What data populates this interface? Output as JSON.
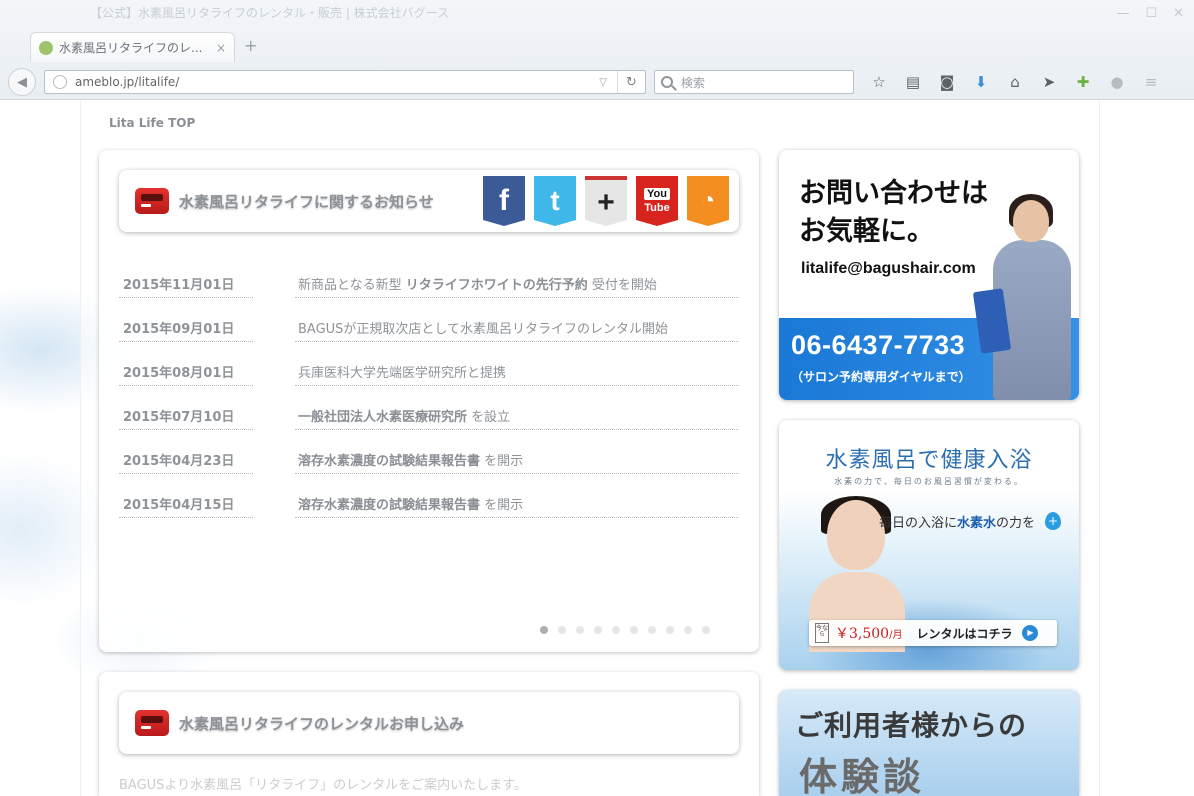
{
  "browser": {
    "window_title": "【公式】水素風呂リタライフのレンタル・販売 | 株式会社バグース",
    "tab_title": "水素風呂リタライフのレ...",
    "tab_close": "×",
    "new_tab": "+",
    "url": "ameblo.jp/litalife/",
    "search_placeholder": "検索"
  },
  "page": {
    "breadcrumb": "Lita Life TOP"
  },
  "news": {
    "title": "水素風呂リタライフに関するお知らせ",
    "social": [
      "f",
      "t",
      "+",
      "You",
      "Tube"
    ],
    "items": [
      {
        "date": "2015年11月01日",
        "pre": "新商品となる新型 ",
        "bold": "リタライフホワイトの先行予約",
        "post": " 受付を開始"
      },
      {
        "date": "2015年09月01日",
        "pre": "BAGUSが正規取次店として水素風呂リタライフのレンタル開始",
        "bold": "",
        "post": ""
      },
      {
        "date": "2015年08月01日",
        "pre": "兵庫医科大学先端医学研究所と提携",
        "bold": "",
        "post": ""
      },
      {
        "date": "2015年07月10日",
        "pre": "",
        "bold": "一般社団法人水素医療研究所",
        "post": " を設立"
      },
      {
        "date": "2015年04月23日",
        "pre": "",
        "bold": "溶存水素濃度の試験結果報告書",
        "post": " を開示"
      },
      {
        "date": "2015年04月15日",
        "pre": "",
        "bold": "溶存水素濃度の試験結果報告書",
        "post": " を開示"
      }
    ],
    "pager_count": 10,
    "pager_active": 0
  },
  "rental": {
    "title": "水素風呂リタライフのレンタルお申し込み",
    "intro": "BAGUSより水素風呂「リタライフ」のレンタルをご案内いたします。"
  },
  "contact_banner": {
    "heading": "お問い合わせは\nお気軽に。",
    "email": "litalife@bagushair.com",
    "phone": "06-6437-7733",
    "note": "（サロン予約専用ダイヤルまで）"
  },
  "bath_banner": {
    "title": "水素風呂で健康入浴",
    "subtitle": "水素の力で、毎日のお風呂習慣が変わる。",
    "tag_pre": "毎日の入浴に",
    "tag_bold": "水素水",
    "tag_post": "の力を",
    "price_badge": "今なら",
    "price": "￥3,500",
    "price_unit": "/月",
    "cta": "レンタルはコチラ"
  },
  "review_banner": {
    "line1": "ご利用者様からの",
    "line2": "体験談"
  },
  "colors": {
    "news_text": "#8e9398",
    "contact_blue": "#1a78d6",
    "bath_title": "#2b6fb1",
    "price_red": "#c42020"
  }
}
